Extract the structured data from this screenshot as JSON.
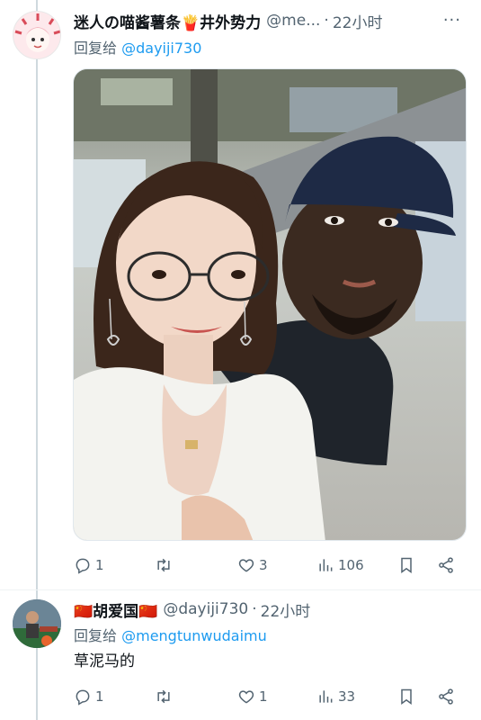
{
  "tweets": [
    {
      "author_name": "迷人の喵酱薯条🍟井外势力",
      "handle": "@me...",
      "dot": "·",
      "time": "22小时",
      "more": "···",
      "reply_prefix": "回复给",
      "reply_to": "@dayiji730",
      "text": "",
      "reply_count": "1",
      "retweet_count": "",
      "like_count": "3",
      "views_count": "106"
    },
    {
      "author_name": "🇨🇳胡爱国🇨🇳",
      "handle": "@dayiji730",
      "dot": "·",
      "time": "22小时",
      "more": "",
      "reply_prefix": "回复给",
      "reply_to": "@mengtunwudaimu",
      "text": "草泥马的",
      "reply_count": "1",
      "retweet_count": "",
      "like_count": "1",
      "views_count": "33"
    }
  ],
  "icons": {
    "reply": "reply-icon",
    "retweet": "retweet-icon",
    "like": "heart-icon",
    "views": "views-icon",
    "bookmark": "bookmark-icon",
    "share": "share-icon"
  },
  "colors": {
    "link": "#1d9bf0",
    "secondary": "#536471",
    "thread_line": "#cfd9de"
  }
}
